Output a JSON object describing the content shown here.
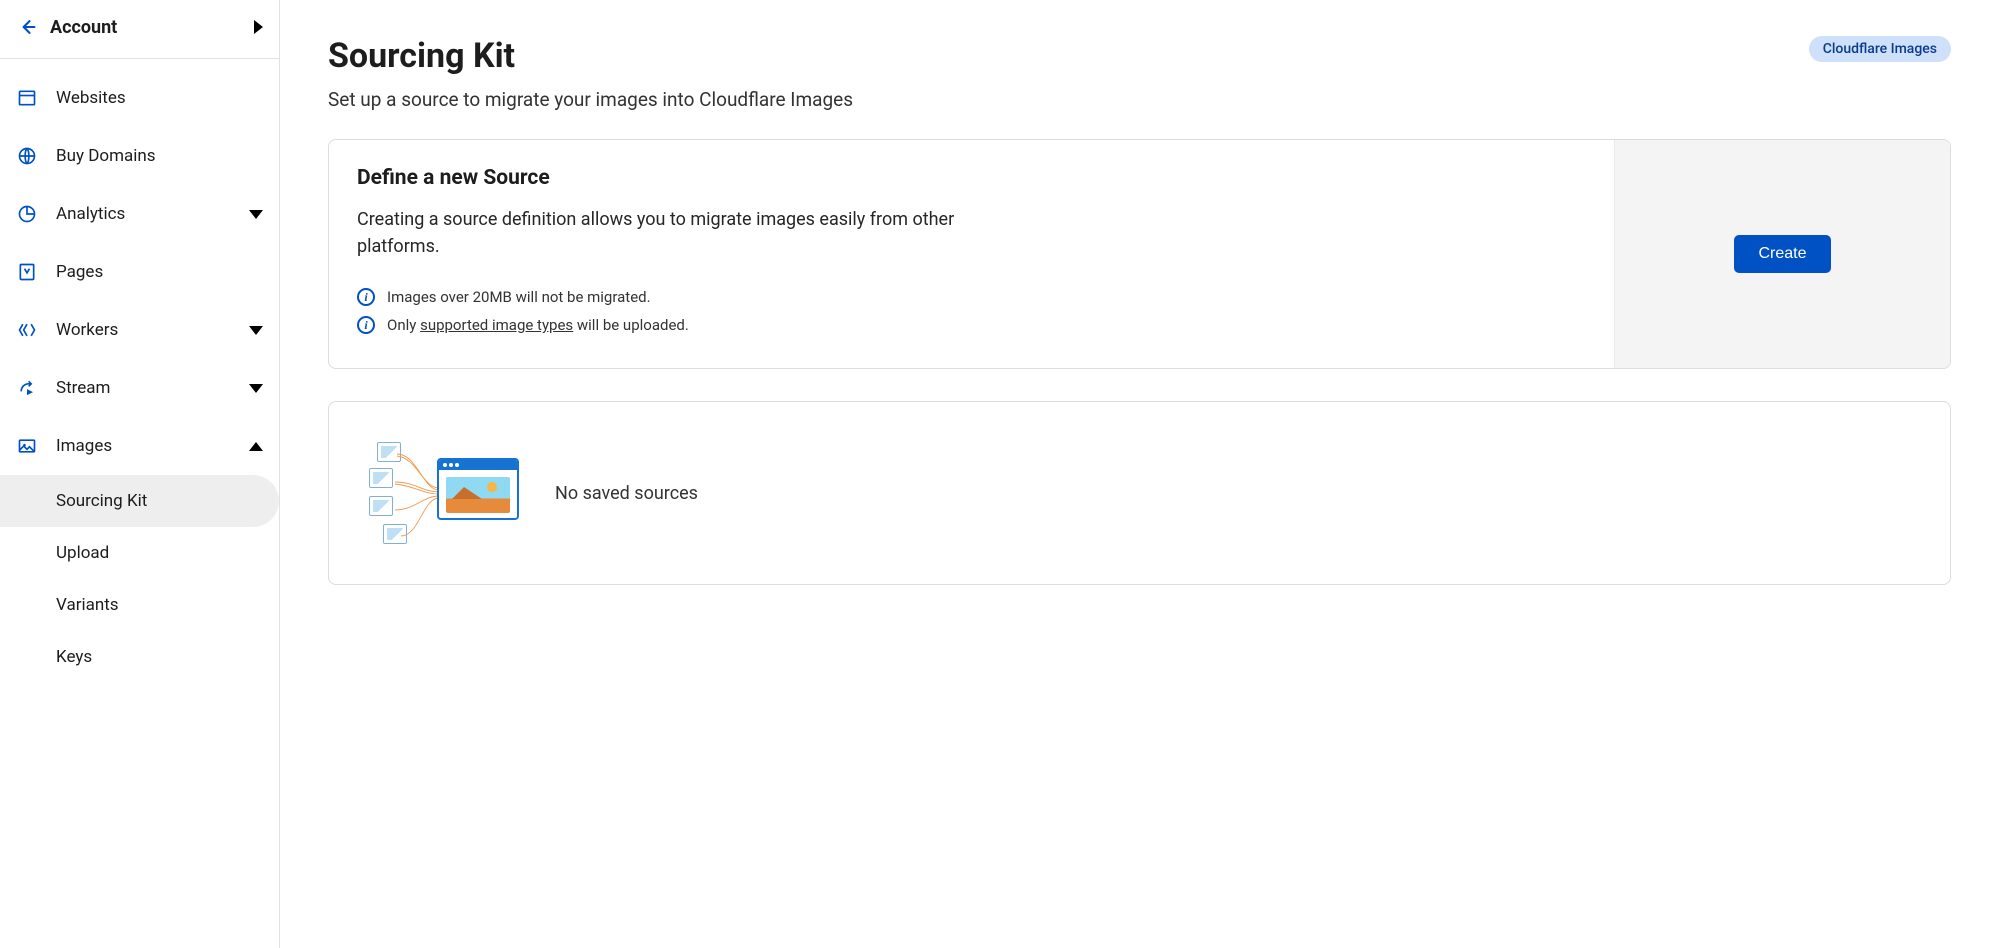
{
  "account_label": "Account",
  "sidebar": {
    "items": [
      {
        "label": "Websites",
        "icon": "browser-icon",
        "expandable": false
      },
      {
        "label": "Buy Domains",
        "icon": "globe-icon",
        "expandable": false
      },
      {
        "label": "Analytics",
        "icon": "analytics-icon",
        "expandable": true,
        "open": false
      },
      {
        "label": "Pages",
        "icon": "pages-icon",
        "expandable": false
      },
      {
        "label": "Workers",
        "icon": "workers-icon",
        "expandable": true,
        "open": false
      },
      {
        "label": "Stream",
        "icon": "stream-icon",
        "expandable": true,
        "open": false
      },
      {
        "label": "Images",
        "icon": "images-icon",
        "expandable": true,
        "open": true
      }
    ],
    "images_sub": [
      {
        "label": "Sourcing Kit",
        "active": true
      },
      {
        "label": "Upload",
        "active": false
      },
      {
        "label": "Variants",
        "active": false
      },
      {
        "label": "Keys",
        "active": false
      }
    ]
  },
  "header": {
    "title": "Sourcing Kit",
    "subtitle": "Set up a source to migrate your images into Cloudflare Images",
    "badge": "Cloudflare Images"
  },
  "define_card": {
    "title": "Define a new Source",
    "description": "Creating a source definition allows you to migrate images easily from other platforms.",
    "note1": "Images over 20MB will not be migrated.",
    "note2_prefix": "Only ",
    "note2_link": "supported image types",
    "note2_suffix": " will be uploaded.",
    "create_label": "Create"
  },
  "empty_state": {
    "message": "No saved sources"
  }
}
